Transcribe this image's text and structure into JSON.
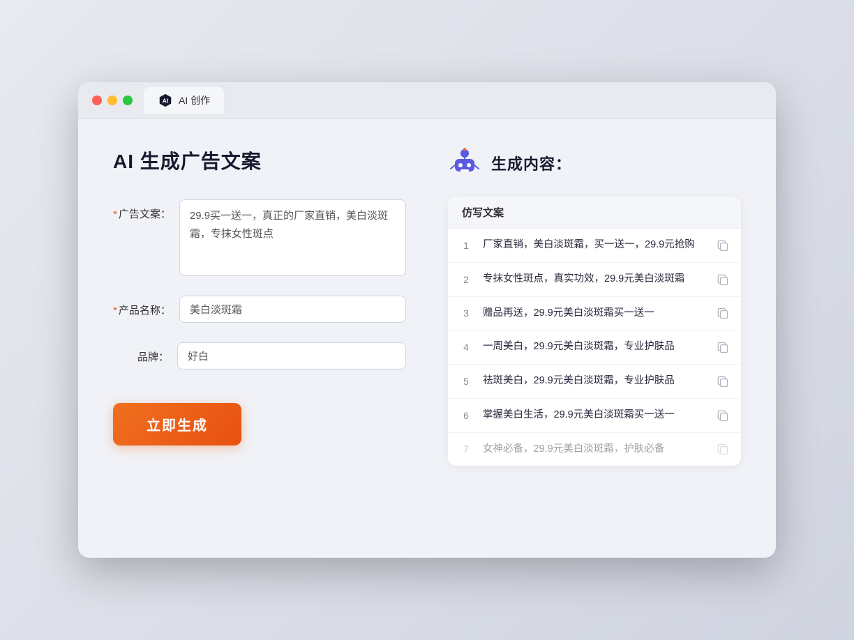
{
  "browser": {
    "tab_label": "AI 创作"
  },
  "page": {
    "title": "AI 生成广告文案",
    "result_title": "生成内容："
  },
  "form": {
    "ad_copy_label": "广告文案：",
    "ad_copy_required": true,
    "ad_copy_value": "29.9买一送一，真正的厂家直销，美白淡斑霜，专抹女性斑点",
    "product_name_label": "产品名称：",
    "product_name_required": true,
    "product_name_value": "美白淡斑霜",
    "brand_label": "品牌：",
    "brand_required": false,
    "brand_value": "好白",
    "button_label": "立即生成"
  },
  "results": {
    "column_label": "仿写文案",
    "items": [
      {
        "num": "1",
        "text": "厂家直销，美白淡斑霜，买一送一，29.9元抢购",
        "faded": false
      },
      {
        "num": "2",
        "text": "专抹女性斑点，真实功效，29.9元美白淡斑霜",
        "faded": false
      },
      {
        "num": "3",
        "text": "赠品再送，29.9元美白淡斑霜买一送一",
        "faded": false
      },
      {
        "num": "4",
        "text": "一周美白，29.9元美白淡斑霜，专业护肤品",
        "faded": false
      },
      {
        "num": "5",
        "text": "祛斑美白，29.9元美白淡斑霜，专业护肤品",
        "faded": false
      },
      {
        "num": "6",
        "text": "掌握美白生活，29.9元美白淡斑霜买一送一",
        "faded": false
      },
      {
        "num": "7",
        "text": "女神必备，29.9元美白淡斑霜，护肤必备",
        "faded": true
      }
    ]
  }
}
